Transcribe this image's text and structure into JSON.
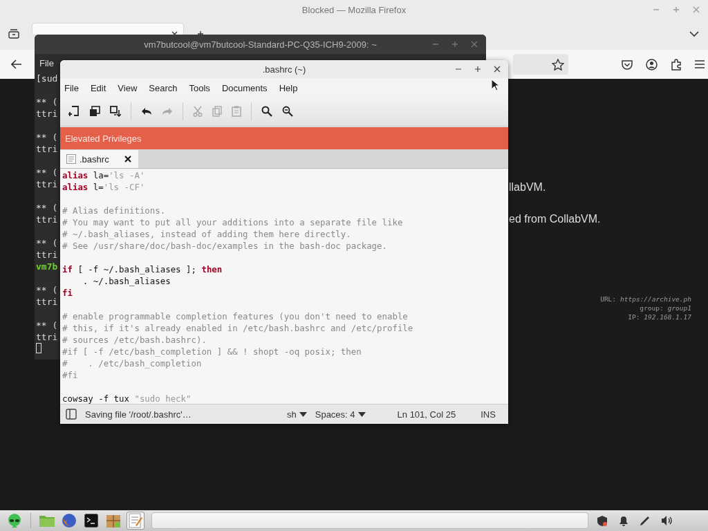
{
  "firefox": {
    "title": "Blocked — Mozilla Firefox",
    "tab": {
      "selected": true
    },
    "page_lines": [
      "llabVM.",
      "ed from CollabVM."
    ],
    "overlay": [
      {
        "label": "URL:",
        "value": "https://archive.ph"
      },
      {
        "label": "group:",
        "value": "group1"
      },
      {
        "label": "IP:",
        "value": "192.168.1.17"
      }
    ]
  },
  "terminal": {
    "title": "vm7butcool@vm7butcool-Standard-PC-Q35-ICH9-2009: ~",
    "menu": [
      "File"
    ],
    "cursor": true,
    "blocks": [
      [
        {
          "kind": "output",
          "text": "[sud"
        }
      ],
      [
        {
          "kind": "output",
          "text": "** ("
        },
        {
          "kind": "output",
          "text": "ttri"
        }
      ],
      [
        {
          "kind": "output",
          "text": "** ("
        },
        {
          "kind": "output",
          "text": "ttri"
        }
      ],
      [
        {
          "kind": "output",
          "text": "** ("
        },
        {
          "kind": "output",
          "text": "ttri"
        }
      ],
      [
        {
          "kind": "output",
          "text": "** ("
        },
        {
          "kind": "output",
          "text": "ttri"
        }
      ],
      [
        {
          "kind": "output",
          "text": "** ("
        },
        {
          "kind": "output",
          "text": "ttri"
        },
        {
          "kind": "prompt",
          "text": "vm7b"
        }
      ],
      [
        {
          "kind": "output",
          "text": "** ("
        },
        {
          "kind": "output",
          "text": "ttri"
        }
      ],
      [
        {
          "kind": "output",
          "text": "** ("
        },
        {
          "kind": "output",
          "text": "ttri"
        }
      ]
    ]
  },
  "editor": {
    "title": ".bashrc (~)",
    "menu": [
      "File",
      "Edit",
      "View",
      "Search",
      "Tools",
      "Documents",
      "Help"
    ],
    "toolbar": [
      [
        {
          "kind": "new",
          "disabled": false
        },
        {
          "kind": "open",
          "disabled": false
        },
        {
          "kind": "save",
          "disabled": false
        }
      ],
      [
        {
          "kind": "undo",
          "disabled": false
        },
        {
          "kind": "redo",
          "disabled": true
        }
      ],
      [
        {
          "kind": "cut",
          "disabled": true
        },
        {
          "kind": "copy",
          "disabled": true
        },
        {
          "kind": "paste",
          "disabled": true
        }
      ],
      [
        {
          "kind": "find",
          "disabled": false
        },
        {
          "kind": "replace",
          "disabled": false
        }
      ]
    ],
    "banner": "Elevated Privileges",
    "tab": {
      "label": ".bashrc",
      "selected": true
    },
    "blocks": [
      [
        [
          {
            "kind": "keyword",
            "text": "alias"
          },
          {
            "kind": "plain",
            "text": " la="
          },
          {
            "kind": "string",
            "text": "'ls -A'"
          }
        ],
        [
          {
            "kind": "keyword",
            "text": "alias"
          },
          {
            "kind": "plain",
            "text": " l="
          },
          {
            "kind": "string",
            "text": "'ls -CF'"
          }
        ]
      ],
      [
        [
          {
            "kind": "comment",
            "text": "# Alias definitions."
          }
        ],
        [
          {
            "kind": "comment",
            "text": "# You may want to put all your additions into a separate file like"
          }
        ],
        [
          {
            "kind": "comment",
            "text": "# ~/.bash_aliases, instead of adding them here directly."
          }
        ],
        [
          {
            "kind": "comment",
            "text": "# See /usr/share/doc/bash-doc/examples in the bash-doc package."
          }
        ]
      ],
      [
        [
          {
            "kind": "keyword",
            "text": "if"
          },
          {
            "kind": "plain",
            "text": " [ -f ~/.bash_aliases ]; "
          },
          {
            "kind": "keyword",
            "text": "then"
          }
        ],
        [
          {
            "kind": "plain",
            "text": "    . ~/.bash_aliases"
          }
        ],
        [
          {
            "kind": "keyword",
            "text": "fi"
          }
        ]
      ],
      [
        [
          {
            "kind": "comment",
            "text": "# enable programmable completion features (you don't need to enable"
          }
        ],
        [
          {
            "kind": "comment",
            "text": "# this, if it's already enabled in /etc/bash.bashrc and /etc/profile"
          }
        ],
        [
          {
            "kind": "comment",
            "text": "# sources /etc/bash.bashrc)."
          }
        ],
        [
          {
            "kind": "comment",
            "text": "#if [ -f /etc/bash_completion ] && ! shopt -oq posix; then"
          }
        ],
        [
          {
            "kind": "comment",
            "text": "#    . /etc/bash_completion"
          }
        ],
        [
          {
            "kind": "comment",
            "text": "#fi"
          }
        ]
      ],
      [
        [
          {
            "kind": "plain",
            "text": "cowsay -f tux "
          },
          {
            "kind": "string",
            "text": "\"sudo heck\""
          }
        ]
      ]
    ],
    "status": {
      "message": "Saving file '/root/.bashrc'…",
      "language": "sh",
      "spaces": "Spaces: 4",
      "position": "Ln 101, Col 25",
      "mode": "INS"
    }
  },
  "taskbar": {
    "launchers": [
      {
        "kind": "menu",
        "active": false
      },
      {
        "kind": "folder",
        "active": false
      },
      {
        "kind": "browser",
        "active": false
      },
      {
        "kind": "terminal",
        "active": false
      },
      {
        "kind": "package",
        "active": false
      },
      {
        "kind": "editor",
        "active": true
      }
    ],
    "tray": [
      {
        "kind": "shield"
      },
      {
        "kind": "bell"
      },
      {
        "kind": "pen"
      },
      {
        "kind": "volume"
      }
    ]
  }
}
